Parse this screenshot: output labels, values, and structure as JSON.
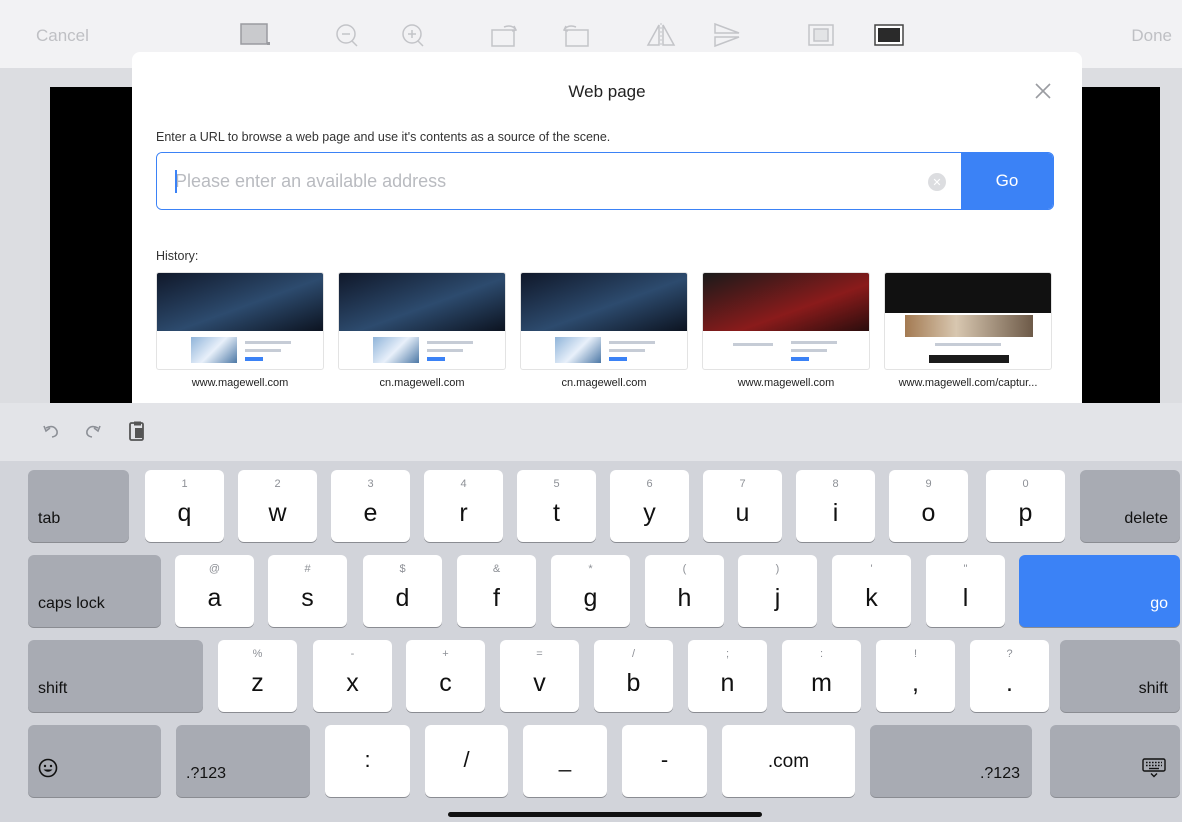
{
  "toolbar": {
    "cancel_label": "Cancel",
    "done_label": "Done",
    "tools": [
      "frame-icon",
      "zoom-out-icon",
      "zoom-in-icon",
      "rotate-right-icon",
      "rotate-left-icon",
      "flip-horizontal-icon",
      "flip-vertical-icon",
      "crop-icon",
      "fill-icon"
    ]
  },
  "dialog": {
    "title": "Web page",
    "description": "Enter a URL to browse a web page and use it's contents as a source of the scene.",
    "url_placeholder": "Please enter an available address",
    "url_value": "",
    "go_label": "Go",
    "history_label": "History:",
    "history": [
      {
        "caption": "www.magewell.com",
        "style": "dark"
      },
      {
        "caption": "cn.magewell.com",
        "style": "dark"
      },
      {
        "caption": "cn.magewell.com",
        "style": "dark"
      },
      {
        "caption": "www.magewell.com",
        "style": "red"
      },
      {
        "caption": "www.magewell.com/captur...",
        "style": "black"
      }
    ]
  },
  "keyboard": {
    "toolbar_icons": [
      "undo-icon",
      "redo-icon",
      "paste-icon"
    ],
    "row1": {
      "tab": "tab",
      "keys": [
        [
          "q",
          "1"
        ],
        [
          "w",
          "2"
        ],
        [
          "e",
          "3"
        ],
        [
          "r",
          "4"
        ],
        [
          "t",
          "5"
        ],
        [
          "y",
          "6"
        ],
        [
          "u",
          "7"
        ],
        [
          "i",
          "8"
        ],
        [
          "o",
          "9"
        ],
        [
          "p",
          "0"
        ]
      ],
      "delete": "delete"
    },
    "row2": {
      "caps": "caps lock",
      "keys": [
        [
          "a",
          "@"
        ],
        [
          "s",
          "#"
        ],
        [
          "d",
          "$"
        ],
        [
          "f",
          "&"
        ],
        [
          "g",
          "*"
        ],
        [
          "h",
          "("
        ],
        [
          "j",
          ")"
        ],
        [
          "k",
          "'"
        ],
        [
          "l",
          "\""
        ]
      ],
      "go": "go"
    },
    "row3": {
      "shift_left": "shift",
      "keys": [
        [
          "z",
          "%"
        ],
        [
          "x",
          "-"
        ],
        [
          "c",
          "+"
        ],
        [
          "v",
          "="
        ],
        [
          "b",
          "/"
        ],
        [
          "n",
          ";"
        ],
        [
          "m",
          ":"
        ],
        [
          ",",
          "!"
        ],
        [
          ".",
          "?"
        ]
      ],
      "shift_right": "shift"
    },
    "row4": {
      "numbers_left": ".?123",
      "colon": ":",
      "slash": "/",
      "underscore": "_",
      "dash": "-",
      "dotcom": ".com",
      "numbers_right": ".?123"
    }
  }
}
